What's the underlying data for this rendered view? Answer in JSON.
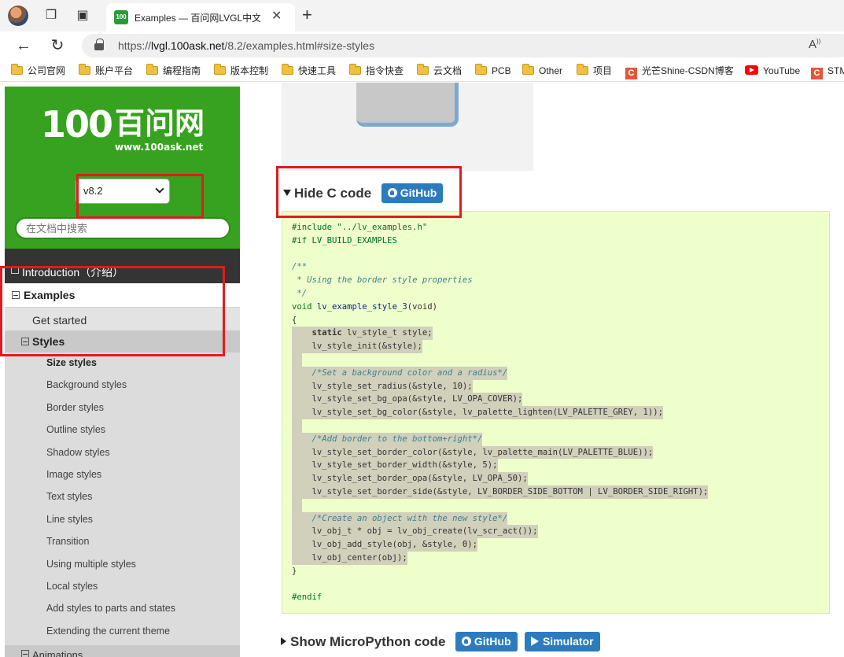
{
  "browser": {
    "tab_title": "Examples — 百问网LVGL中文教程",
    "url_host": "lvgl.100ask.net",
    "url_prefix": "https://",
    "url_path": "/8.2/examples.html#size-styles",
    "read_aloud": "A",
    "bookmarks": [
      {
        "label": "公司官网",
        "icon": "folder-icon"
      },
      {
        "label": "账户平台",
        "icon": "folder-icon"
      },
      {
        "label": "编程指南",
        "icon": "folder-icon"
      },
      {
        "label": "版本控制",
        "icon": "folder-icon"
      },
      {
        "label": "快速工具",
        "icon": "folder-icon"
      },
      {
        "label": "指令快查",
        "icon": "folder-icon"
      },
      {
        "label": "云文档",
        "icon": "folder-icon"
      },
      {
        "label": "PCB",
        "icon": "folder-icon"
      },
      {
        "label": "Other",
        "icon": "folder-icon"
      },
      {
        "label": "项目",
        "icon": "folder-icon"
      },
      {
        "label": "光芒Shine-CSDN博客",
        "icon": "csdn-icon"
      },
      {
        "label": "YouTube",
        "icon": "youtube-icon"
      },
      {
        "label": "STM",
        "icon": "csdn-icon"
      }
    ]
  },
  "sidebar": {
    "logo_mark": "100",
    "logo_text": "百问网",
    "logo_url": "www.100ask.net",
    "version": "v8.2",
    "search_placeholder": "在文档中搜索",
    "intro_label": "Introduction（介绍）",
    "examples_label": "Examples",
    "get_started_label": "Get started",
    "styles_label": "Styles",
    "style_items": [
      "Size styles",
      "Background styles",
      "Border styles",
      "Outline styles",
      "Shadow styles",
      "Image styles",
      "Text styles",
      "Line styles",
      "Transition",
      "Using multiple styles",
      "Local styles",
      "Add styles to parts and states",
      "Extending the current theme"
    ],
    "active_item": "Size styles",
    "animations_label": "Animations"
  },
  "main": {
    "hide_c_code_label": "Hide C code",
    "github_label": "GitHub",
    "show_micropython_label": "Show MicroPython code",
    "simulator_label": "Simulator",
    "code": {
      "include": "#include \"../lv_examples.h\"",
      "if_build": "#if LV_BUILD_EXAMPLES",
      "comment_open": "/**",
      "comment_body": " * Using the border style properties",
      "comment_close": " */",
      "func_sig_void": "void",
      "func_sig_name": "lv_example_style_3",
      "func_sig_args": "(void)",
      "brace_open": "{",
      "l_static_kw": "static",
      "l_static_rest": " lv_style_t style;",
      "l_init": "lv_style_init(&style);",
      "c_bg": "/*Set a background color and a radius*/",
      "l_radius": "lv_style_set_radius(&style, 10);",
      "l_bg_opa": "lv_style_set_bg_opa(&style, LV_OPA_COVER);",
      "l_bg_color": "lv_style_set_bg_color(&style, lv_palette_lighten(LV_PALETTE_GREY, 1));",
      "c_border": "/*Add border to the bottom+right*/",
      "l_border_color": "lv_style_set_border_color(&style, lv_palette_main(LV_PALETTE_BLUE));",
      "l_border_width": "lv_style_set_border_width(&style, 5);",
      "l_border_opa": "lv_style_set_border_opa(&style, LV_OPA_50);",
      "l_border_side": "lv_style_set_border_side(&style, LV_BORDER_SIDE_BOTTOM | LV_BORDER_SIDE_RIGHT);",
      "c_create": "/*Create an object with the new style*/",
      "l_obj_create": "lv_obj_t * obj = lv_obj_create(lv_scr_act());",
      "l_add_style": "lv_obj_add_style(obj, &style, 0);",
      "l_center": "lv_obj_center(obj);",
      "brace_close": "}",
      "endif": "#endif"
    }
  },
  "colors": {
    "brand_green": "#37a21f",
    "button_blue": "#2b7bbf",
    "code_bg": "#eeffcc",
    "annotation_red": "#e01c1c"
  }
}
